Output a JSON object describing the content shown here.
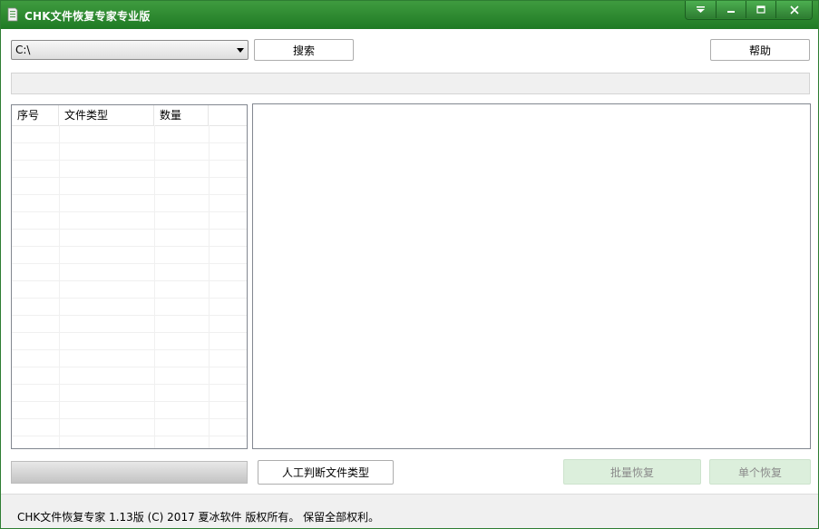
{
  "window": {
    "title": "CHK文件恢复专家专业版",
    "accent_color": "#2e7d32",
    "controls": [
      "dropdown-icon",
      "minimize-icon",
      "maximize-icon",
      "close-icon"
    ]
  },
  "toolbar": {
    "drive_value": "C:\\",
    "search_label": "搜索",
    "help_label": "帮助"
  },
  "file_list": {
    "columns": [
      "序号",
      "文件类型",
      "数量"
    ],
    "rows": []
  },
  "actions": {
    "manual_detect_label": "人工判断文件类型",
    "batch_recover_label": "批量恢复",
    "single_recover_label": "单个恢复"
  },
  "status": {
    "text": "CHK文件恢复专家 1.13版 (C) 2017 夏冰软件 版权所有。 保留全部权利。"
  }
}
